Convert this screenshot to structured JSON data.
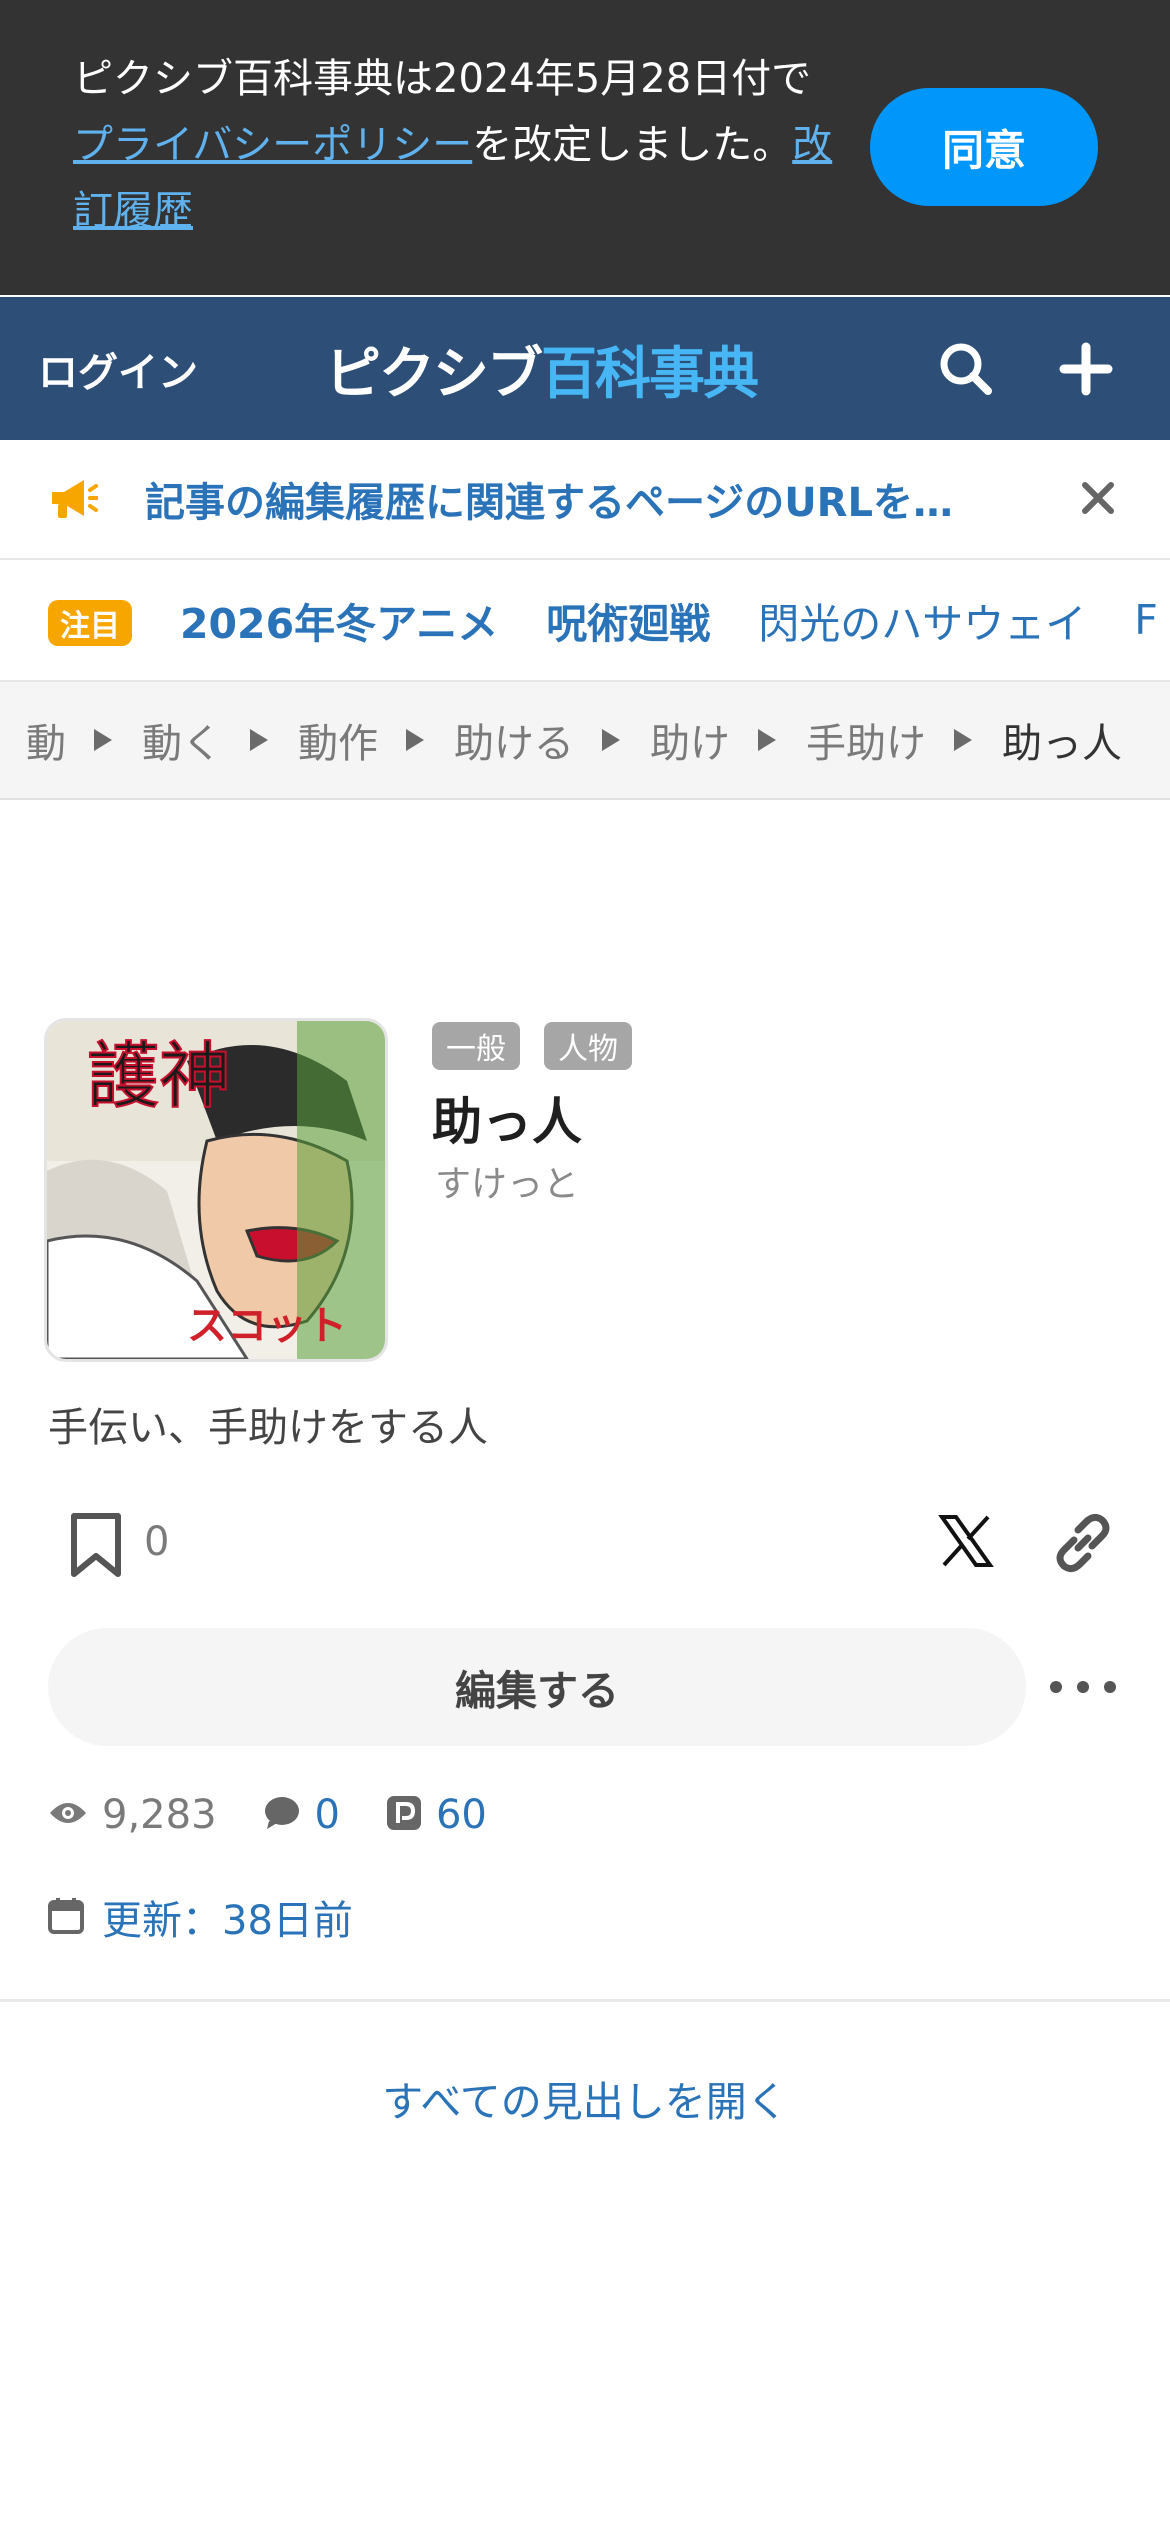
{
  "consent": {
    "text_before": "ピクシブ百科事典は2024年5月28日付で",
    "privacy_link": "プライバシーポリシー",
    "text_middle": "を改定しました。",
    "history_link": "改訂履歴",
    "agree_button": "同意"
  },
  "header": {
    "login": "ログイン",
    "logo_part1": "ピクシブ",
    "logo_part2": "百科事典",
    "search_icon": "search-icon",
    "plus_icon": "plus-icon"
  },
  "notice": {
    "text": "記事の編集履歴に関連するページのURLを…",
    "icon": "megaphone-icon"
  },
  "trending": {
    "badge": "注目",
    "items": [
      {
        "label": "2026年冬アニメ",
        "bold": true
      },
      {
        "label": "呪術廻戦",
        "bold": true
      },
      {
        "label": "閃光のハサウェイ",
        "bold": false
      },
      {
        "label": "F",
        "bold": false
      }
    ]
  },
  "breadcrumb": {
    "items": [
      "動",
      "動く",
      "動作",
      "助ける",
      "助け",
      "手助け"
    ],
    "current": "助っ人"
  },
  "article": {
    "tags": [
      "一般",
      "人物"
    ],
    "title": "助っ人",
    "reading": "すけっと",
    "summary": "手伝い、手助けをする人",
    "bookmark_count": "0",
    "edit_button": "編集する",
    "stats": {
      "views": "9,283",
      "comments": "0",
      "pixiv_works": "60"
    },
    "updated": "更新：38日前",
    "thumbnail_text": "護神"
  },
  "toc": {
    "open_all": "すべての見出しを開く"
  },
  "colors": {
    "header_bg": "#2d4e77",
    "accent_blue": "#2a73b8",
    "agree_button": "#0096fa",
    "badge": "#f7a600"
  }
}
